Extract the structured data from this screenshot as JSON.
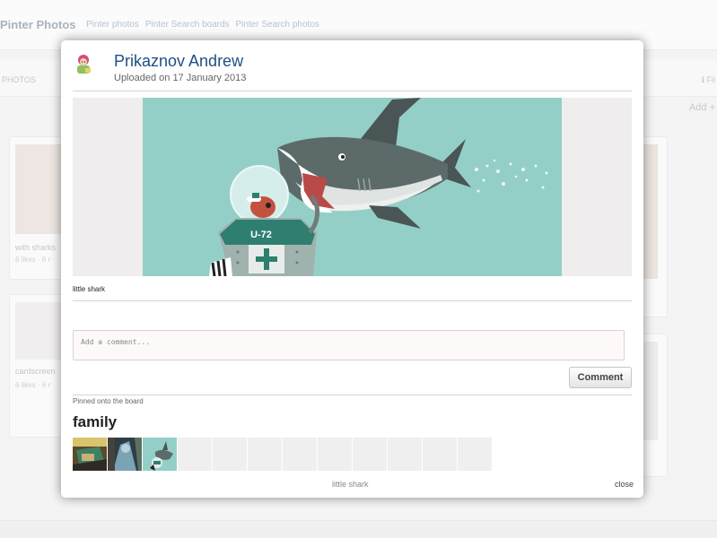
{
  "background": {
    "logo": "Pinter Photos",
    "nav_links": [
      "Pinter photos",
      "Pinter Search boards",
      "Pinter Search photos"
    ],
    "tab_label": "PHOTOS",
    "right_link": "ℹ Fil",
    "add_label": "Add +",
    "cards": [
      {
        "title": "with sharks",
        "meta": "6 likes · 6 r"
      },
      {
        "title": "cardscreen",
        "meta": "6 likes · 6 r"
      }
    ]
  },
  "modal": {
    "user_name": "Prikaznov Andrew",
    "upload_date": "Uploaded on 17 January 2013",
    "image_alt": "little shark",
    "caption": "little shark",
    "comment_placeholder": "Add a comment...",
    "comment_button": "Comment",
    "pinned_label": "Pinned onto the board",
    "board_name": "family",
    "thumbnails": [
      "photo-1",
      "photo-2",
      "photo-3",
      "",
      "",
      "",
      "",
      "",
      "",
      "",
      "",
      ""
    ],
    "bottom_caption": "little shark",
    "close_label": "close"
  },
  "colors": {
    "accent_name": "#1d4f83",
    "image_bg": "#93cfc7"
  }
}
